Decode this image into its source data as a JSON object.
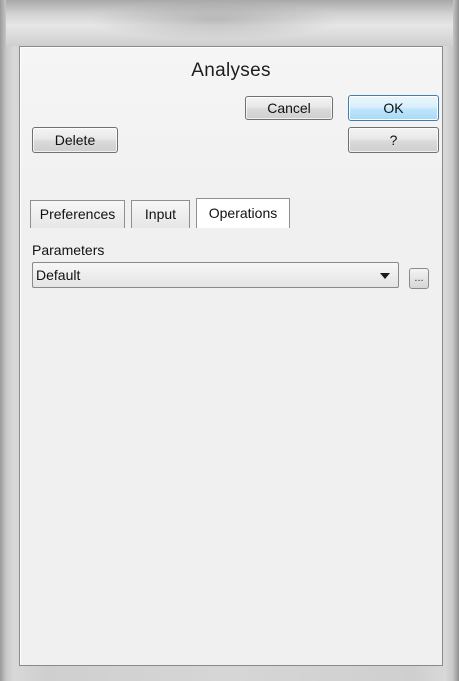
{
  "dialog": {
    "title": "Analyses",
    "buttons": {
      "cancel": "Cancel",
      "ok": "OK",
      "delete": "Delete",
      "help": "?"
    },
    "tabs": [
      {
        "label": "Preferences",
        "active": false
      },
      {
        "label": "Input",
        "active": false
      },
      {
        "label": "Operations",
        "active": true
      }
    ],
    "parameters": {
      "label": "Parameters",
      "selected": "Default",
      "browse_label": "..."
    }
  }
}
